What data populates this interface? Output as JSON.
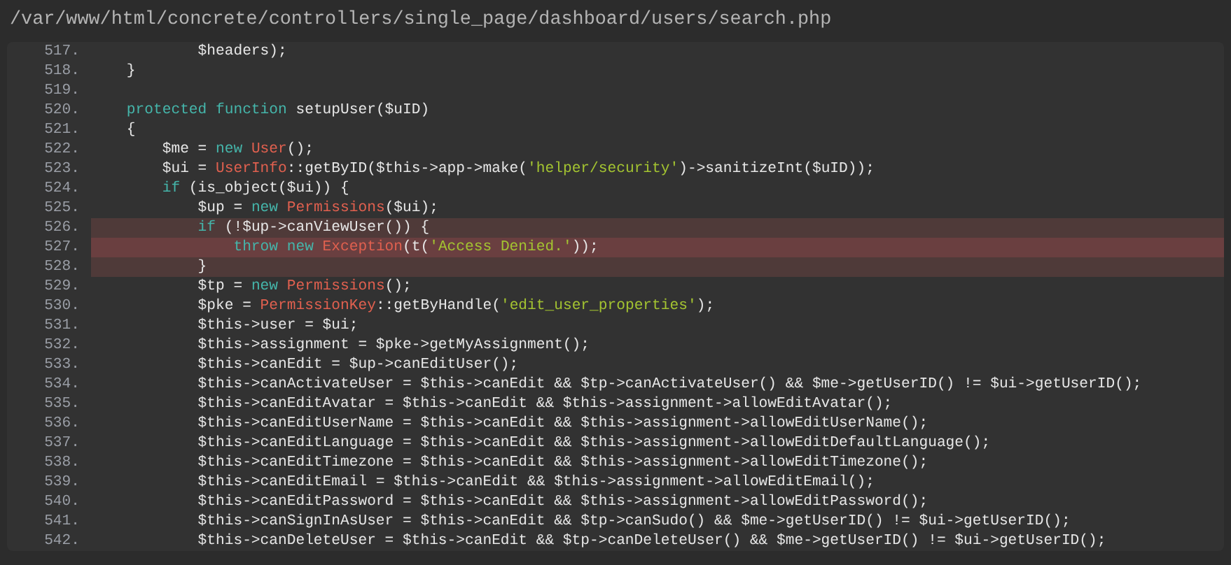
{
  "file_path": "/var/www/html/concrete/controllers/single_page/dashboard/users/search.php",
  "lines": [
    {
      "number": "517.",
      "highlighted": false,
      "error": false,
      "code": [
        {
          "kind": "plain",
          "text": "            $headers);"
        }
      ]
    },
    {
      "number": "518.",
      "highlighted": false,
      "error": false,
      "code": [
        {
          "kind": "plain",
          "text": "    }"
        }
      ]
    },
    {
      "number": "519.",
      "highlighted": false,
      "error": false
    },
    {
      "number": "520.",
      "highlighted": false,
      "error": false,
      "code": [
        {
          "kind": "keyword",
          "text": "    protected function"
        },
        {
          "kind": "plain",
          "text": " setupUser($uID)"
        }
      ]
    },
    {
      "number": "521.",
      "highlighted": false,
      "error": false,
      "code": [
        {
          "kind": "plain",
          "text": "    {"
        }
      ]
    },
    {
      "number": "522.",
      "highlighted": false,
      "error": false,
      "code": [
        {
          "kind": "plain",
          "text": "        $me = "
        },
        {
          "kind": "keyword",
          "text": "new "
        },
        {
          "kind": "class",
          "text": "User"
        },
        {
          "kind": "plain",
          "text": "();"
        }
      ]
    },
    {
      "number": "523.",
      "highlighted": false,
      "error": false,
      "code": [
        {
          "kind": "plain",
          "text": "        $ui = "
        },
        {
          "kind": "class",
          "text": "UserInfo"
        },
        {
          "kind": "plain",
          "text": "::getByID($this->app->make("
        },
        {
          "kind": "string",
          "text": "'helper/security'"
        },
        {
          "kind": "plain",
          "text": ")->sanitizeInt($uID));"
        }
      ]
    },
    {
      "number": "524.",
      "highlighted": false,
      "error": false,
      "code": [
        {
          "kind": "keyword",
          "text": "        if"
        },
        {
          "kind": "plain",
          "text": " (is_object($ui)) {"
        }
      ]
    },
    {
      "number": "525.",
      "highlighted": false,
      "error": false,
      "code": [
        {
          "kind": "plain",
          "text": "            $up = "
        },
        {
          "kind": "keyword",
          "text": "new "
        },
        {
          "kind": "class",
          "text": "Permissions"
        },
        {
          "kind": "plain",
          "text": "($ui);"
        }
      ]
    },
    {
      "number": "526.",
      "highlighted": true,
      "error": false,
      "code": [
        {
          "kind": "keyword",
          "text": "            if"
        },
        {
          "kind": "plain",
          "text": " (!$up->canViewUser()) {"
        }
      ]
    },
    {
      "number": "527.",
      "highlighted": true,
      "error": true,
      "code": [
        {
          "kind": "keyword",
          "text": "                throw new "
        },
        {
          "kind": "class",
          "text": "Exception"
        },
        {
          "kind": "plain",
          "text": "(t("
        },
        {
          "kind": "string",
          "text": "'Access Denied.'"
        },
        {
          "kind": "plain",
          "text": "));"
        }
      ]
    },
    {
      "number": "528.",
      "highlighted": true,
      "error": false,
      "code": [
        {
          "kind": "plain",
          "text": "            }"
        }
      ]
    },
    {
      "number": "529.",
      "highlighted": false,
      "error": false,
      "code": [
        {
          "kind": "plain",
          "text": "            $tp = "
        },
        {
          "kind": "keyword",
          "text": "new "
        },
        {
          "kind": "class",
          "text": "Permissions"
        },
        {
          "kind": "plain",
          "text": "();"
        }
      ]
    },
    {
      "number": "530.",
      "highlighted": false,
      "error": false,
      "code": [
        {
          "kind": "plain",
          "text": "            $pke = "
        },
        {
          "kind": "class",
          "text": "PermissionKey"
        },
        {
          "kind": "plain",
          "text": "::getByHandle("
        },
        {
          "kind": "string",
          "text": "'edit_user_properties'"
        },
        {
          "kind": "plain",
          "text": ");"
        }
      ]
    },
    {
      "number": "531.",
      "highlighted": false,
      "error": false,
      "code": [
        {
          "kind": "plain",
          "text": "            $this->user = $ui;"
        }
      ]
    },
    {
      "number": "532.",
      "highlighted": false,
      "error": false,
      "code": [
        {
          "kind": "plain",
          "text": "            $this->assignment = $pke->getMyAssignment();"
        }
      ]
    },
    {
      "number": "533.",
      "highlighted": false,
      "error": false,
      "code": [
        {
          "kind": "plain",
          "text": "            $this->canEdit = $up->canEditUser();"
        }
      ]
    },
    {
      "number": "534.",
      "highlighted": false,
      "error": false,
      "code": [
        {
          "kind": "plain",
          "text": "            $this->canActivateUser = $this->canEdit && $tp->canActivateUser() && $me->getUserID() != $ui->getUserID();"
        }
      ]
    },
    {
      "number": "535.",
      "highlighted": false,
      "error": false,
      "code": [
        {
          "kind": "plain",
          "text": "            $this->canEditAvatar = $this->canEdit && $this->assignment->allowEditAvatar();"
        }
      ]
    },
    {
      "number": "536.",
      "highlighted": false,
      "error": false,
      "code": [
        {
          "kind": "plain",
          "text": "            $this->canEditUserName = $this->canEdit && $this->assignment->allowEditUserName();"
        }
      ]
    },
    {
      "number": "537.",
      "highlighted": false,
      "error": false,
      "code": [
        {
          "kind": "plain",
          "text": "            $this->canEditLanguage = $this->canEdit && $this->assignment->allowEditDefaultLanguage();"
        }
      ]
    },
    {
      "number": "538.",
      "highlighted": false,
      "error": false,
      "code": [
        {
          "kind": "plain",
          "text": "            $this->canEditTimezone = $this->canEdit && $this->assignment->allowEditTimezone();"
        }
      ]
    },
    {
      "number": "539.",
      "highlighted": false,
      "error": false,
      "code": [
        {
          "kind": "plain",
          "text": "            $this->canEditEmail = $this->canEdit && $this->assignment->allowEditEmail();"
        }
      ]
    },
    {
      "number": "540.",
      "highlighted": false,
      "error": false,
      "code": [
        {
          "kind": "plain",
          "text": "            $this->canEditPassword = $this->canEdit && $this->assignment->allowEditPassword();"
        }
      ]
    },
    {
      "number": "541.",
      "highlighted": false,
      "error": false,
      "code": [
        {
          "kind": "plain",
          "text": "            $this->canSignInAsUser = $this->canEdit && $tp->canSudo() && $me->getUserID() != $ui->getUserID();"
        }
      ]
    },
    {
      "number": "542.",
      "highlighted": false,
      "error": false,
      "code": [
        {
          "kind": "plain",
          "text": "            $this->canDeleteUser = $this->canEdit && $tp->canDeleteUser() && $me->getUserID() != $ui->getUserID();"
        }
      ]
    }
  ]
}
